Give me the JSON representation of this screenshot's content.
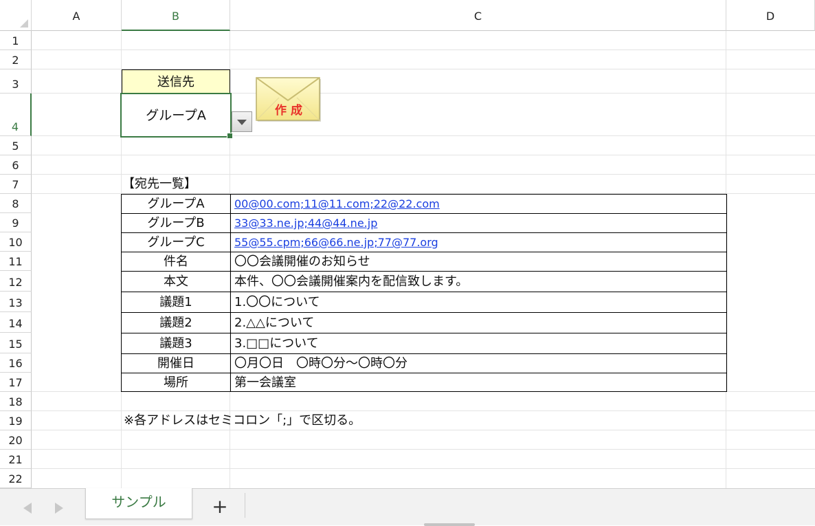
{
  "columns": [
    "A",
    "B",
    "C",
    "D"
  ],
  "rows": [
    "1",
    "2",
    "3",
    "4",
    "5",
    "6",
    "7",
    "8",
    "9",
    "10",
    "11",
    "12",
    "13",
    "14",
    "15",
    "16",
    "17",
    "18",
    "19",
    "20",
    "21",
    "22"
  ],
  "selection": {
    "column": "B",
    "row": "4"
  },
  "dropdown": {
    "header": "送信先",
    "value": "グループA"
  },
  "create_button": {
    "label": "作 成"
  },
  "list_title": "【宛先一覧】",
  "table": [
    {
      "label": "グループA",
      "value": "00@00.com;11@11.com;22@22.com",
      "link": true
    },
    {
      "label": "グループB",
      "value": "33@33.ne.jp;44@44.ne.jp",
      "link": true
    },
    {
      "label": "グループC",
      "value": "55@55.cpm;66@66.ne.jp;77@77.org",
      "link": true
    },
    {
      "label": "件名",
      "value": "〇〇会議開催のお知らせ",
      "link": false
    },
    {
      "label": "本文",
      "value": "本件、〇〇会議開催案内を配信致します。",
      "link": false
    },
    {
      "label": "議題1",
      "value": "1.〇〇について",
      "link": false
    },
    {
      "label": "議題2",
      "value": "2.△△について",
      "link": false
    },
    {
      "label": "議題3",
      "value": "3.□□について",
      "link": false
    },
    {
      "label": "開催日",
      "value": "〇月〇日　〇時〇分～〇時〇分",
      "link": false
    },
    {
      "label": "場所",
      "value": "第一会議室",
      "link": false
    }
  ],
  "note": "※各アドレスはセミコロン「;」で区切る。",
  "sheet_tab": "サンプル",
  "add_sheet": "+",
  "colors": {
    "accent": "#3a7a43",
    "link": "#1a3fe0",
    "header_fill": "#ffffcc",
    "create_text": "#e8322a"
  }
}
